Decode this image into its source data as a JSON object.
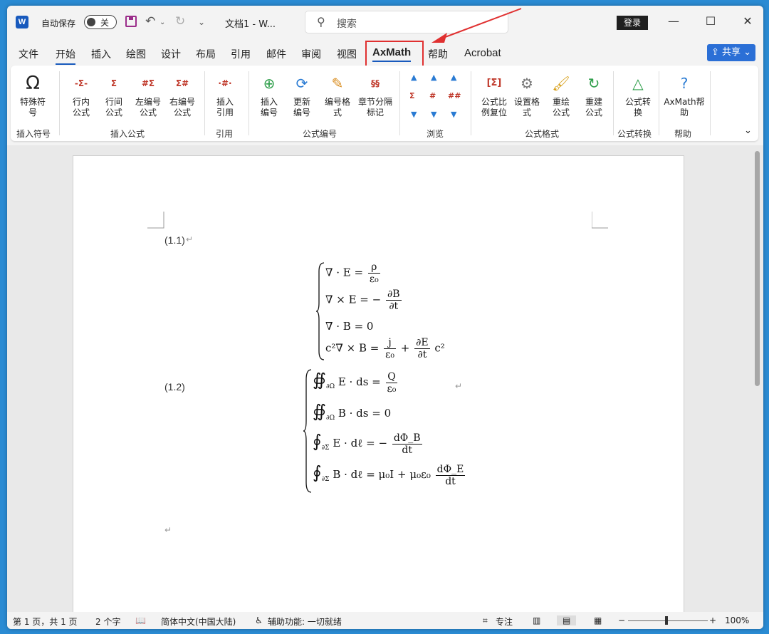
{
  "titlebar": {
    "autosave_label": "自动保存",
    "autosave_state": "关",
    "doc_title": "文档1 - W...",
    "search_placeholder": "搜索",
    "login": "登录",
    "minimize": "—",
    "maximize": "☐",
    "close": "✕"
  },
  "tabs": [
    "文件",
    "开始",
    "插入",
    "绘图",
    "设计",
    "布局",
    "引用",
    "邮件",
    "审阅",
    "视图",
    "AxMath",
    "帮助",
    "Acrobat"
  ],
  "share_label": "共享",
  "ribbon": {
    "special_symbol": "特殊符号",
    "group_insert_symbol": "插入符号",
    "inline_formula": "行内公式",
    "display_formula": "行间公式",
    "left_num_formula": "左编号公式",
    "right_num_formula": "右编号公式",
    "group_insert_formula": "插入公式",
    "insert_ref": "插入引用",
    "group_ref": "引用",
    "insert_number": "插入编号",
    "update_number": "更新编号",
    "number_format": "编号格式",
    "chapter_mark": "章节分隔标记",
    "group_numbering": "公式编号",
    "group_browse": "浏览",
    "formula_scale_reset": "公式比例复位",
    "set_format": "设置格式",
    "redraw_formula": "重绘公式",
    "rebuild_formula": "重建公式",
    "group_formula_format": "公式格式",
    "formula_convert": "公式转换",
    "group_formula_convert": "公式转换",
    "axmath_help": "AxMath帮助",
    "group_help": "帮助"
  },
  "document": {
    "eq1_number": "(1.1)",
    "eq2_number": "(1.2)",
    "para_mark": "↵",
    "eq1": {
      "l1": "∇ · E =",
      "l1_num": "ρ",
      "l1_den": "ε₀",
      "l2": "∇ × E = −",
      "l2_num": "∂B",
      "l2_den": "∂t",
      "l3": "∇ · B = 0",
      "l4a": "c²∇ × B =",
      "l4_num1": "j",
      "l4_den1": "ε₀",
      "l4_plus": "+",
      "l4_num2": "∂E",
      "l4_den2": "∂t",
      "l4_tail": "c²"
    },
    "eq2": {
      "int1": "∯",
      "sub1": "∂Ω",
      "l1": "E · ds =",
      "l1_num": "Q",
      "l1_den": "ε₀",
      "int2": "∯",
      "sub2": "∂Ω",
      "l2": "B · ds = 0",
      "int3": "∮",
      "sub3": "∂Σ",
      "l3": "E · dℓ = −",
      "l3_num": "dΦ_B",
      "l3_den": "dt",
      "int4": "∮",
      "sub4": "∂Σ",
      "l4": "B · dℓ = μ₀I + μ₀ε₀",
      "l4_num": "dΦ_E",
      "l4_den": "dt"
    }
  },
  "statusbar": {
    "pages": "第 1 页，共 1 页",
    "words": "2 个字",
    "language": "简体中文(中国大陆)",
    "accessibility": "辅助功能: 一切就绪",
    "focus": "专注",
    "zoom_minus": "−",
    "zoom_plus": "+",
    "zoom": "100%"
  }
}
